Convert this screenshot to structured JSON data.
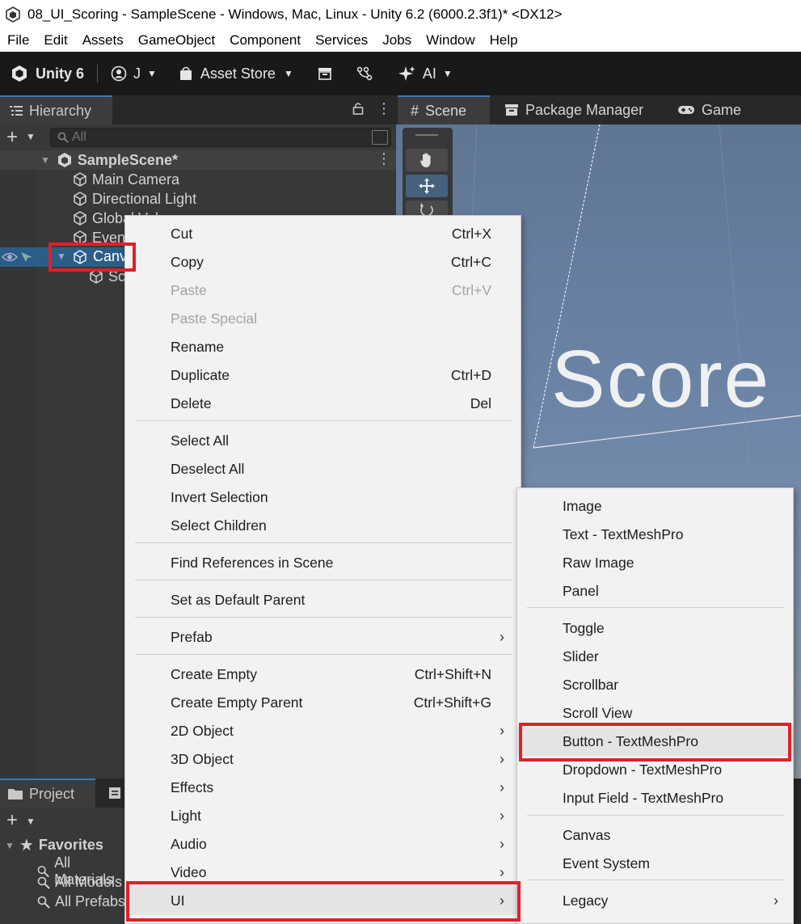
{
  "window": {
    "title": "08_UI_Scoring - SampleScene - Windows, Mac, Linux - Unity 6.2 (6000.2.3f1)* <DX12>"
  },
  "menubar": [
    "File",
    "Edit",
    "Assets",
    "GameObject",
    "Component",
    "Services",
    "Jobs",
    "Window",
    "Help"
  ],
  "toolbar": {
    "unity_label": "Unity 6",
    "account_label": "J",
    "asset_store_label": "Asset Store",
    "ai_label": "AI"
  },
  "hierarchy": {
    "tab_label": "Hierarchy",
    "search_placeholder": "All",
    "scene_name": "SampleScene*",
    "items": [
      "Main Camera",
      "Directional Light",
      "Global Volume",
      "EventSystem",
      "Canvas",
      "Score"
    ]
  },
  "scene_tabs": [
    "Scene",
    "Package Manager",
    "Game"
  ],
  "scene_view": {
    "overlay_text": "Score"
  },
  "project": {
    "tab_label": "Project",
    "favorites_label": "Favorites",
    "favorites": [
      "All Materials",
      "All Models",
      "All Prefabs"
    ]
  },
  "context_menu": {
    "items": [
      {
        "label": "Cut",
        "shortcut": "Ctrl+X"
      },
      {
        "label": "Copy",
        "shortcut": "Ctrl+C"
      },
      {
        "label": "Paste",
        "shortcut": "Ctrl+V",
        "disabled": true
      },
      {
        "label": "Paste Special",
        "disabled": true
      },
      {
        "label": "Rename"
      },
      {
        "label": "Duplicate",
        "shortcut": "Ctrl+D"
      },
      {
        "label": "Delete",
        "shortcut": "Del"
      },
      {
        "label": "Select All"
      },
      {
        "label": "Deselect All"
      },
      {
        "label": "Invert Selection"
      },
      {
        "label": "Select Children"
      },
      {
        "label": "Find References in Scene"
      },
      {
        "label": "Set as Default Parent"
      },
      {
        "label": "Prefab",
        "submenu": true
      },
      {
        "label": "Create Empty",
        "shortcut": "Ctrl+Shift+N"
      },
      {
        "label": "Create Empty Parent",
        "shortcut": "Ctrl+Shift+G"
      },
      {
        "label": "2D Object",
        "submenu": true
      },
      {
        "label": "3D Object",
        "submenu": true
      },
      {
        "label": "Effects",
        "submenu": true
      },
      {
        "label": "Light",
        "submenu": true
      },
      {
        "label": "Audio",
        "submenu": true
      },
      {
        "label": "Video",
        "submenu": true
      },
      {
        "label": "UI",
        "submenu": true
      }
    ]
  },
  "ui_submenu": {
    "items": [
      {
        "label": "Image"
      },
      {
        "label": "Text - TextMeshPro"
      },
      {
        "label": "Raw Image"
      },
      {
        "label": "Panel"
      },
      {
        "label": "Toggle"
      },
      {
        "label": "Slider"
      },
      {
        "label": "Scrollbar"
      },
      {
        "label": "Scroll View"
      },
      {
        "label": "Button - TextMeshPro"
      },
      {
        "label": "Dropdown - TextMeshPro"
      },
      {
        "label": "Input Field - TextMeshPro"
      },
      {
        "label": "Canvas"
      },
      {
        "label": "Event System"
      },
      {
        "label": "Legacy",
        "submenu": true
      }
    ]
  },
  "colors": {
    "highlight_red": "#e0202a",
    "selection_blue": "#2c5d87",
    "tab_accent": "#3a79bb"
  }
}
